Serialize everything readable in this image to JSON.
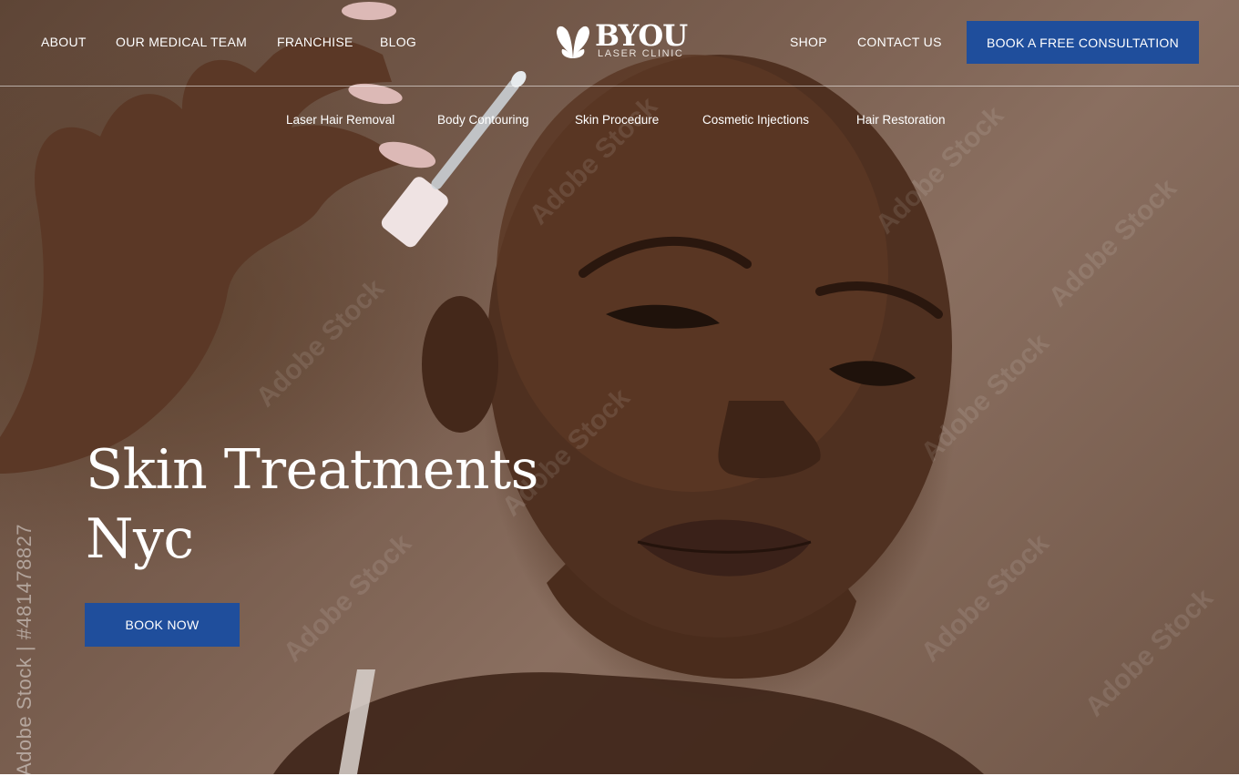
{
  "header": {
    "nav_left": [
      "ABOUT",
      "OUR MEDICAL TEAM",
      "FRANCHISE",
      "BLOG"
    ],
    "nav_right": [
      "SHOP",
      "CONTACT US"
    ],
    "logo_word": "BYOU",
    "logo_sub": "LASER CLINIC",
    "cta_label": "BOOK A FREE CONSULTATION"
  },
  "subnav": [
    "Laser Hair Removal",
    "Body Contouring",
    "Skin Procedure",
    "Cosmetic Injections",
    "Hair Restoration"
  ],
  "hero": {
    "headline_line1": "Skin Treatments",
    "headline_line2": "Nyc",
    "button_label": "BOOK NOW",
    "stock_text": "Adobe Stock | #481478827",
    "watermark": "Adobe Stock"
  },
  "colors": {
    "brand_blue": "#1f4e9c",
    "hero_bg": "#7a5f50"
  }
}
